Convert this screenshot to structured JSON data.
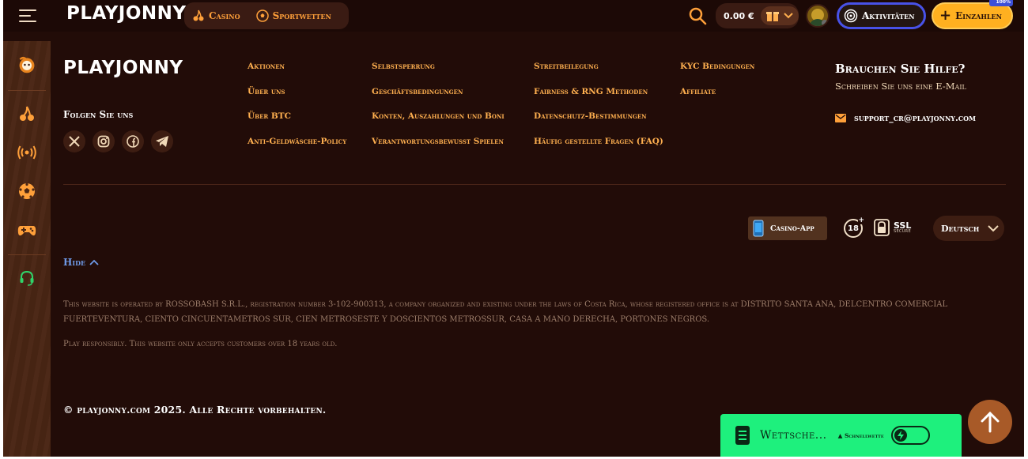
{
  "header": {
    "logo": "PLAYJONNY",
    "nav": [
      {
        "label": "Casino",
        "icon": "cherry-icon"
      },
      {
        "label": "Sportwetten",
        "icon": "soccer-ball-icon"
      }
    ],
    "balance": "0.00 €",
    "activities_label": "Aktivitäten",
    "deposit_label": "Einzahlen",
    "badge_percent": "100%"
  },
  "sidebar": {
    "icons": [
      "pumpkin-logo-icon",
      "cherry-icon",
      "live-broadcast-icon",
      "soccer-ball-icon",
      "gamepad-icon",
      "support-headset-icon"
    ]
  },
  "footer": {
    "logo": "PLAYJONNY",
    "follow_label": "Folgen Sie uns",
    "socials": [
      "x-icon",
      "instagram-icon",
      "facebook-icon",
      "telegram-icon"
    ],
    "columns": [
      [
        "Aktionen",
        "Über uns",
        "Über BTC",
        "Anti-Geldwäsche-Policy"
      ],
      [
        "Selbstsperrung",
        "Geschäftsbedingungen",
        "Konten, Auszahlungen und Boni",
        "Verantwortungsbewusst Spielen"
      ],
      [
        "Streitbeilegung",
        "Fairness & RNG Methoden",
        "Datenschutz-Bestimmungen",
        "Häufig gestellte Fragen (FAQ)"
      ],
      [
        "KYC Bedingungen",
        "Affiliate"
      ]
    ],
    "help": {
      "title": "Brauchen Sie Hilfe?",
      "subtitle": "Schreiben Sie uns eine E-Mail",
      "email": "support_cr@playjonny.com"
    },
    "casino_app_label": "Casino-App",
    "age_label": "18",
    "age_plus": "+",
    "ssl_label": "SSL",
    "ssl_sub": "SECURE",
    "language": "Deutsch",
    "hide_label": "Hide",
    "legal_text": "This website is operated by ROSSOBASH S.R.L., registration number 3-102-900313, a company organized and existing under the laws of Costa Rica, whose registered office is at DISTRITO SANTA ANA, DELCENTRO COMERCIAL FUERTEVENTURA, CIENTO CINCUENTAMETROS SUR, CIEN METROSESTE Y DOSCIENTOS METROSSUR, CASA A MANO DERECHA, PORTONES NEGROS.",
    "responsible_text": "Play responsibly. This website only accepts customers over 18 years old.",
    "copyright": "© playjonny.com 2025. Alle Rechte vorbehalten."
  },
  "betslip": {
    "label": "Wettsche...",
    "quick_label": "Schnellwette"
  },
  "colors": {
    "background": "#220c08",
    "accent_orange": "#ffb050",
    "deposit_yellow": "#ffb020",
    "activities_blue": "#4852e8",
    "betslip_green": "#1ef07d",
    "hide_blue": "#6f9ae8"
  }
}
